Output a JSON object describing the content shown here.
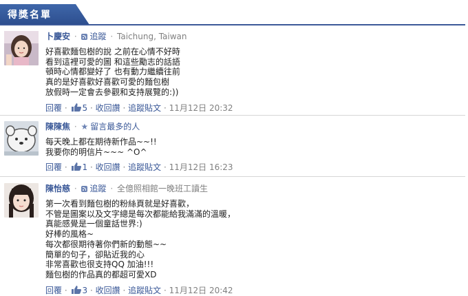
{
  "header": {
    "title": "得獎名單"
  },
  "comments": [
    {
      "author": "卜慶安",
      "follow": "追蹤",
      "subtitle": "Taichung, Taiwan",
      "text": "好喜歡麵包樹的說 之前在心情不好時\n看到這裡可愛的圖 和這些勵志的話語\n頓時心情都變好了 也有動力繼續往前\n真的是好喜歡好喜歡可愛的麵包樹\n放假時一定會去參觀和支持展覽的:))",
      "reply": "回覆",
      "likes": "5",
      "unlike": "收回讚",
      "follow_post": "追蹤貼文",
      "time": "11月12日 20:32"
    },
    {
      "author": "陳陳焦",
      "subtitle": "留言最多的人",
      "text": "每天晚上都在期待新作品~~!!\n我要你的明信片~~~ ^O^",
      "reply": "回覆",
      "likes": "1",
      "unlike": "收回讚",
      "follow_post": "追蹤貼文",
      "time": "11月12日 16:23"
    },
    {
      "author": "陳怡慈",
      "follow": "追蹤",
      "subtitle": "全億照相館一晚班工讀生",
      "text": "第一次看到麵包樹的粉絲頁就是好喜歡，\n不管是圖案以及文字總是每次都能給我滿滿的溫暖，\n真能感覺是一個童話世界:)\n好棒的風格~\n每次都很期待著你們新的動態~~\n簡單的句子，卻貼近我的心\n非常喜歡也很支持QQ 加油!!!\n麵包樹的作品真的都超可愛XD",
      "reply": "回覆",
      "likes": "3",
      "unlike": "收回讚",
      "follow_post": "追蹤貼文",
      "time": "11月12日 20:42"
    }
  ]
}
